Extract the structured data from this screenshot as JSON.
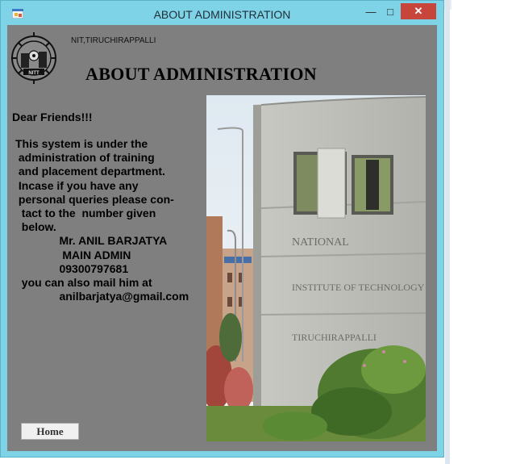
{
  "window": {
    "title": "ABOUT ADMINISTRATION",
    "minimize_symbol": "—",
    "maximize_symbol": "□",
    "close_symbol": "✕"
  },
  "header": {
    "institute": "NIT,TIRUCHIRAPPALLI",
    "heading": "ABOUT ADMINISTRATION",
    "logo_text": "NITT"
  },
  "content": {
    "greeting": "Dear Friends!!!",
    "body_lines": [
      "This system is under the",
      " administration of training",
      " and placement department.",
      " Incase if you have any",
      " personal queries please con-",
      "  tact to the  number given",
      "  below."
    ],
    "admin_name": "Mr. ANIL BARJATYA",
    "admin_role": "MAIN ADMIN",
    "phone": "09300797681",
    "mail_line": "you can also mail him at",
    "email": "anilbarjatya@gmail.com"
  },
  "photo": {
    "sign_line1": "NATIONAL",
    "sign_line2": "INSTITUTE OF TECHNOLOGY",
    "sign_line3": "TIRUCHIRAPPALLI"
  },
  "buttons": {
    "home": "Home"
  },
  "colors": {
    "window_frame": "#7fd3e6",
    "client_bg": "#7f7f7f",
    "close_button": "#c7453a"
  }
}
